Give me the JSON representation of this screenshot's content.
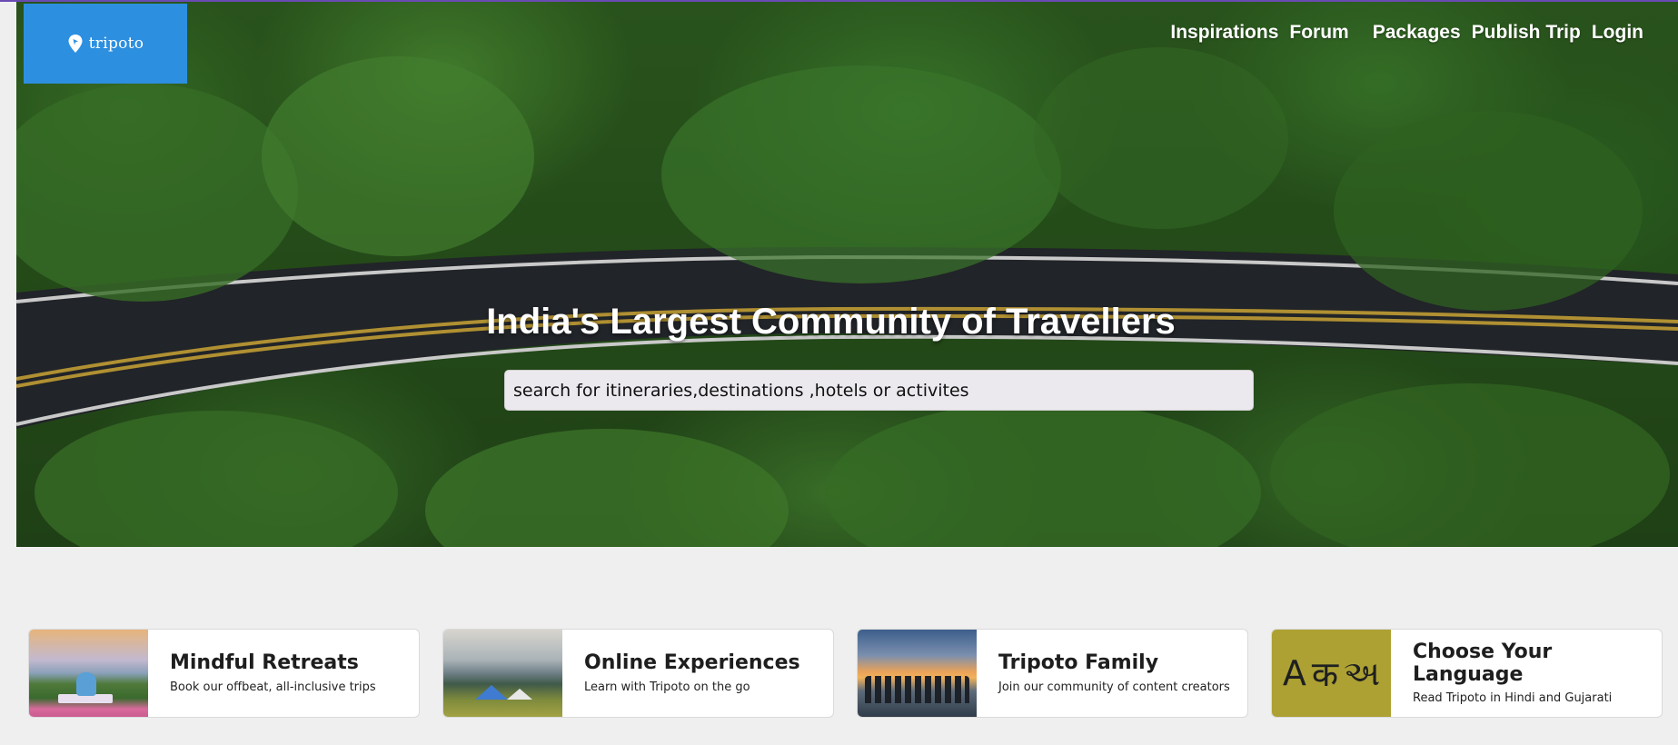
{
  "brand": {
    "name": "tripoto",
    "logo_icon": "map-pin-icon",
    "logo_color": "#2d8fe0"
  },
  "nav": {
    "items": [
      {
        "label": "Inspirations"
      },
      {
        "label": "Forum"
      },
      {
        "label": "Packages"
      },
      {
        "label": "Publish Trip"
      },
      {
        "label": "Login"
      }
    ]
  },
  "hero": {
    "headline": "India's Largest Community of Travellers",
    "search_placeholder": "search for itineraries,destinations ,hotels or activites"
  },
  "cards": [
    {
      "title": "Mindful Retreats",
      "subtitle": "Book our offbeat, all-inclusive trips",
      "image": "yoga-retreat-image"
    },
    {
      "title": "Online Experiences",
      "subtitle": "Learn with Tripoto on the go",
      "image": "camping-image"
    },
    {
      "title": "Tripoto Family",
      "subtitle": "Join our community of content creators",
      "image": "group-sunset-image"
    },
    {
      "title": "Choose Your Language",
      "subtitle": "Read Tripoto in Hindi and Gujarati",
      "image": "language-glyphs-image",
      "glyphs": [
        "A",
        "क",
        "અ"
      ]
    }
  ]
}
